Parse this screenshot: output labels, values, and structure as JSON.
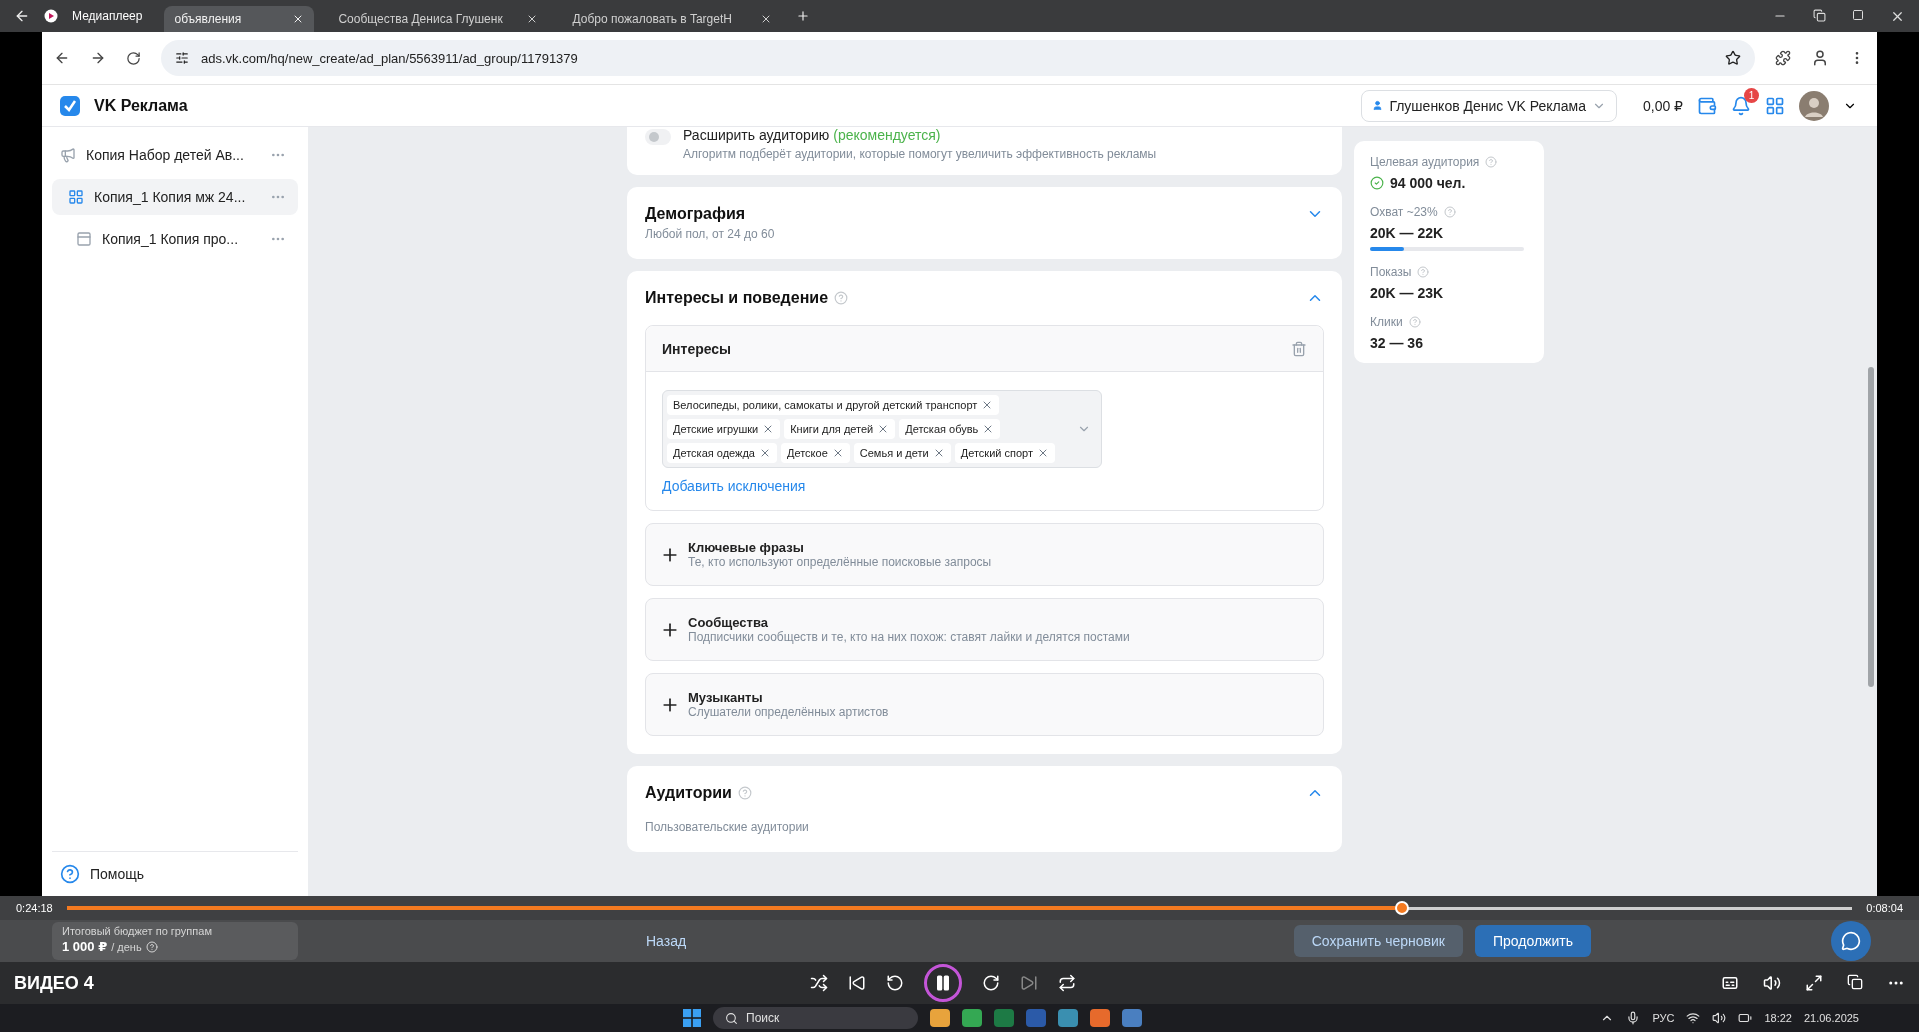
{
  "player": {
    "title": "Медиаплеер",
    "video_title": "ВИДЕО 4",
    "elapsed": "0:24:18",
    "remaining": "0:08:04",
    "level": 0.748,
    "playing": true
  },
  "browser": {
    "tabs": [
      {
        "label": "объявления",
        "selected": true
      },
      {
        "label": "Сообщества Дениса Глушенк",
        "selected": false
      },
      {
        "label": "Добро пожаловать в TargetH",
        "selected": false
      }
    ],
    "url": "ads.vk.com/hq/new_create/ad_plan/5563911/ad_group/11791379"
  },
  "header": {
    "logo": "VK Реклама",
    "account": "Глушенков Денис VK Реклама",
    "balance": "0,00 ₽",
    "notifications": "1"
  },
  "sidebar": {
    "items": [
      {
        "label": "Копия Набор детей Ав...",
        "kind": "campaign",
        "selected": false
      },
      {
        "label": "Копия_1 Копия мж 24...",
        "kind": "group",
        "selected": true
      },
      {
        "label": "Копия_1 Копия про...",
        "kind": "ad",
        "selected": false
      }
    ],
    "help": "Помощь",
    "budget": {
      "label": "Итоговый бюджет по группам",
      "value": "1 000 ₽",
      "unit": "/ день"
    }
  },
  "expand": {
    "on": false,
    "label": "Расширить аудиторию",
    "hint": "(рекомендуется)",
    "description": "Алгоритм подберёт аудитории, которые помогут увеличить эффективность рекламы"
  },
  "demography": {
    "title": "Демография",
    "subtitle": "Любой пол, от 24 до 60",
    "expanded": false
  },
  "interests": {
    "title": "Интересы и поведение",
    "expanded": true,
    "block_title": "Интересы",
    "tags": [
      "Велосипеды, ролики, самокаты и другой детский транспорт",
      "Детские игрушки",
      "Книги для детей",
      "Детская обувь",
      "Детская одежда",
      "Детское",
      "Семья и дети",
      "Детский спорт"
    ],
    "add_link": "Добавить исключения",
    "options": [
      {
        "title": "Ключевые фразы",
        "description": "Те, кто используют определённые поисковые запросы"
      },
      {
        "title": "Сообщества",
        "description": "Подписчики сообществ и те, кто на них похож: ставят лайки и делятся постами"
      },
      {
        "title": "Музыканты",
        "description": "Слушатели определённых артистов"
      }
    ]
  },
  "audiences": {
    "title": "Аудитории",
    "expanded": true,
    "subtitle": "Пользовательские аудитории"
  },
  "footer": {
    "back": "Назад",
    "save": "Сохранить черновик",
    "next": "Продолжить"
  },
  "forecast": [
    {
      "kind": "verified",
      "label": "Целевая аудитория",
      "value": "94 000 чел."
    },
    {
      "kind": "meter",
      "label": "Охват ~23%",
      "value": "20K — 22K",
      "level": 0.22
    },
    {
      "kind": "plain",
      "label": "Показы",
      "value": "20K — 23K"
    },
    {
      "kind": "plain",
      "label": "Клики",
      "value": "32 — 36"
    }
  ],
  "taskbar": {
    "search": "Поиск",
    "language": "РУС",
    "time": "18:22",
    "date": "21.06.2025"
  }
}
